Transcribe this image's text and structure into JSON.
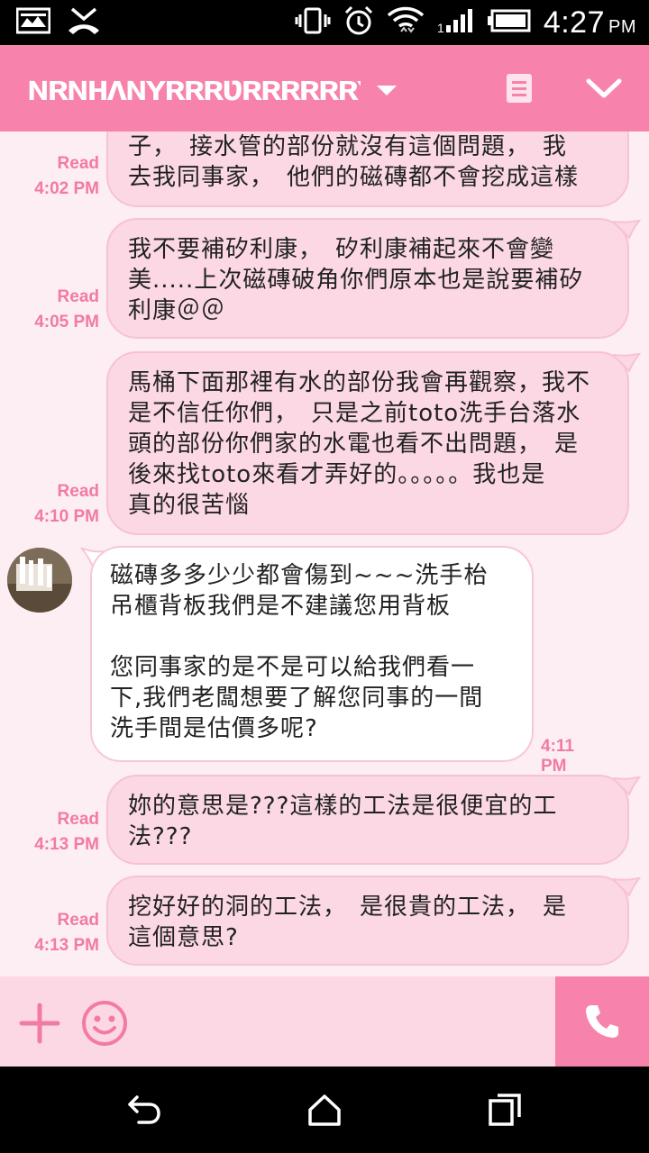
{
  "status_bar": {
    "time": "4:27",
    "ampm": "PM",
    "icons": [
      "image-notification-icon",
      "missed-call-icon",
      "vibrate-icon",
      "alarm-icon",
      "wifi-icon",
      "signal-icon",
      "battery-icon"
    ]
  },
  "header": {
    "title": "ɴʀɴʜʌɴʏʀʀʀʋʀʀʀʀʀʀʏɴʜ",
    "title_note": "redacted contact name (scribbled out)",
    "icons": [
      "dropdown-caret-icon",
      "notes-icon",
      "chevron-down-icon"
    ]
  },
  "messages": [
    {
      "direction": "out",
      "lines": [
        "子，　接水管的部份就沒有這個問題，　我",
        "去我同事家，　他們的磁磚都不會挖成這樣"
      ],
      "read": "Read",
      "time": "4:02 PM"
    },
    {
      "direction": "out",
      "lines": [
        "我不要補矽利康，　矽利康補起來不會變",
        "美.....上次磁磚破角你們原本也是說要補矽",
        "利康＠＠"
      ],
      "read": "Read",
      "time": "4:05 PM"
    },
    {
      "direction": "out",
      "lines": [
        "馬桶下面那裡有水的部份我會再觀察，我不",
        "是不信任你們，　只是之前toto洗手台落水",
        "頭的部份你們家的水電也看不出問題，　是",
        "後來找toto來看才弄好的。。。。。我也是",
        "真的很苦惱"
      ],
      "read": "Read",
      "time": "4:10 PM"
    },
    {
      "direction": "in",
      "lines": [
        "磁磚多多少少都會傷到~~~洗手枱",
        "吊櫃背板我們是不建議您用背板",
        "",
        "您同事家的是不是可以給我們看一",
        "下,我們老闆想要了解您同事的一間",
        "洗手間是估價多呢?"
      ],
      "time": "4:11 PM"
    },
    {
      "direction": "out",
      "lines": [
        "妳的意思是???這樣的工法是很便宜的工",
        "法???"
      ],
      "read": "Read",
      "time": "4:13 PM"
    },
    {
      "direction": "out",
      "lines": [
        "挖好好的洞的工法，　是很貴的工法，　是",
        "這個意思?"
      ],
      "read": "Read",
      "time": "4:13 PM"
    }
  ],
  "input_bar": {
    "icons": [
      "plus-icon",
      "emoji-icon",
      "phone-icon"
    ]
  },
  "nav_bar": {
    "icons": [
      "back-icon",
      "home-icon",
      "recent-apps-icon"
    ]
  },
  "colors": {
    "header": "#f783ac",
    "background": "#fdeef3",
    "outgoing_bubble": "#fbd8e4",
    "incoming_bubble": "#ffffff",
    "meta_text": "#f27aa3"
  }
}
